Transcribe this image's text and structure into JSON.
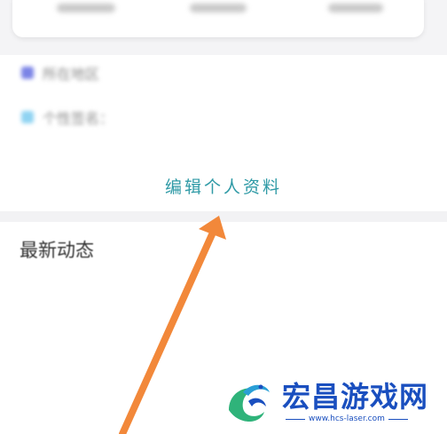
{
  "profile": {
    "stats": [
      "关注数",
      "粉丝数",
      "点赞数"
    ],
    "info_rows": [
      {
        "icon": "location-icon",
        "text": "所在地区",
        "color": "#7b84e6"
      },
      {
        "icon": "signature-icon",
        "text": "个性签名：",
        "color": "#8fd3f2"
      }
    ],
    "edit_profile_label": "编辑个人资料"
  },
  "feed": {
    "title": "最新动态"
  },
  "watermark": {
    "title": "宏昌游戏网",
    "url": "www.hcs-laser.com"
  },
  "colors": {
    "edit_link": "#2f9aa6",
    "arrow": "#f2883a",
    "watermark": "#1a4fbf"
  }
}
